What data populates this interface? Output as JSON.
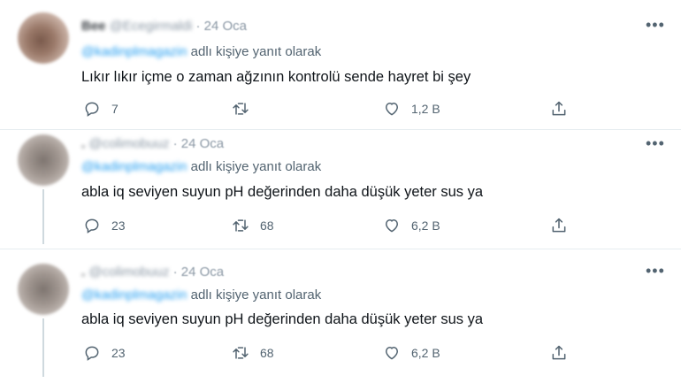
{
  "tweets": [
    {
      "name": "Bee",
      "handle": "@Ecegirmaldi",
      "date": "· 24 Oca",
      "mention": "@kadinplmagazin",
      "reply_suffix": "adlı kişiye yanıt olarak",
      "text": "Lıkır lıkır içme o zaman ağzının kontrolü sende hayret bi şey",
      "more": "•••",
      "replies": "7",
      "retweets": "",
      "likes": "1,2 B"
    },
    {
      "name": ".",
      "handle": "@colimobuuz",
      "date": "· 24 Oca",
      "mention": "@kadinplmagazin",
      "reply_suffix": "adlı kişiye yanıt olarak",
      "text": "abla iq seviyen suyun pH değerinden daha düşük yeter sus ya",
      "more": "•••",
      "replies": "23",
      "retweets": "68",
      "likes": "6,2 B"
    },
    {
      "name": ".",
      "handle": "@colimobuuz",
      "date": "· 24 Oca",
      "mention": "@kadinplmagazin",
      "reply_suffix": "adlı kişiye yanıt olarak",
      "text": "abla iq seviyen suyun pH değerinden daha düşük yeter sus ya",
      "more": "•••",
      "replies": "23",
      "retweets": "68",
      "likes": "6,2 B"
    }
  ],
  "icons": {
    "reply": "reply-icon",
    "retweet": "retweet-icon",
    "like": "like-icon",
    "share": "share-icon",
    "more": "more-icon"
  },
  "colors": {
    "mention": "#1d9bf0",
    "secondary": "#536471",
    "text": "#0f1419",
    "separator": "#e6ecf0"
  }
}
